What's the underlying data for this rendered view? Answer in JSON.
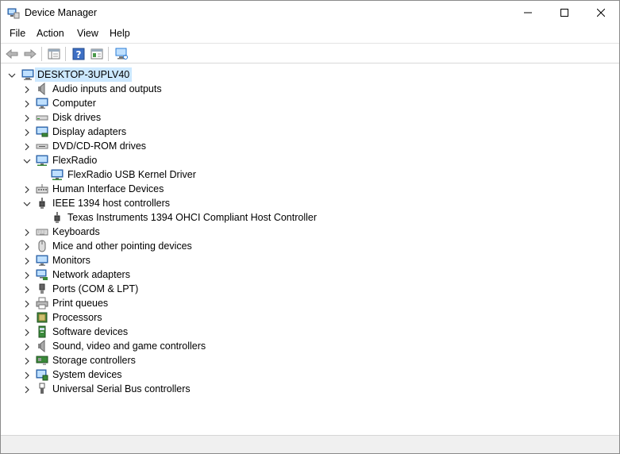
{
  "window": {
    "title": "Device Manager"
  },
  "menu": {
    "file": "File",
    "action": "Action",
    "view": "View",
    "help": "Help"
  },
  "tree": {
    "root": "DESKTOP-3UPLV40",
    "categories": [
      {
        "label": "Audio inputs and outputs",
        "icon": "speaker-icon",
        "expanded": false
      },
      {
        "label": "Computer",
        "icon": "monitor-icon",
        "expanded": false
      },
      {
        "label": "Disk drives",
        "icon": "disk-drive-icon",
        "expanded": false
      },
      {
        "label": "Display adapters",
        "icon": "display-adapter-icon",
        "expanded": false
      },
      {
        "label": "DVD/CD-ROM drives",
        "icon": "dvd-drive-icon",
        "expanded": false
      },
      {
        "label": "FlexRadio",
        "icon": "network-monitor-icon",
        "expanded": true,
        "children": [
          "FlexRadio USB Kernel Driver"
        ]
      },
      {
        "label": "Human Interface Devices",
        "icon": "hid-icon",
        "expanded": false
      },
      {
        "label": "IEEE 1394 host controllers",
        "icon": "firewire-icon",
        "expanded": true,
        "children": [
          "Texas Instruments 1394 OHCI Compliant Host Controller"
        ]
      },
      {
        "label": "Keyboards",
        "icon": "keyboard-icon",
        "expanded": false
      },
      {
        "label": "Mice and other pointing devices",
        "icon": "mouse-icon",
        "expanded": false
      },
      {
        "label": "Monitors",
        "icon": "monitor-icon",
        "expanded": false
      },
      {
        "label": "Network adapters",
        "icon": "network-adapter-icon",
        "expanded": false
      },
      {
        "label": "Ports (COM & LPT)",
        "icon": "port-icon",
        "expanded": false
      },
      {
        "label": "Print queues",
        "icon": "printer-icon",
        "expanded": false
      },
      {
        "label": "Processors",
        "icon": "processor-icon",
        "expanded": false
      },
      {
        "label": "Software devices",
        "icon": "software-device-icon",
        "expanded": false
      },
      {
        "label": "Sound, video and game controllers",
        "icon": "speaker-icon",
        "expanded": false
      },
      {
        "label": "Storage controllers",
        "icon": "storage-controller-icon",
        "expanded": false
      },
      {
        "label": "System devices",
        "icon": "system-devices-icon",
        "expanded": false
      },
      {
        "label": "Universal Serial Bus controllers",
        "icon": "usb-icon",
        "expanded": false
      }
    ]
  },
  "colors": {
    "selection": "#cce8ff",
    "accent": "#2a7bd4"
  }
}
